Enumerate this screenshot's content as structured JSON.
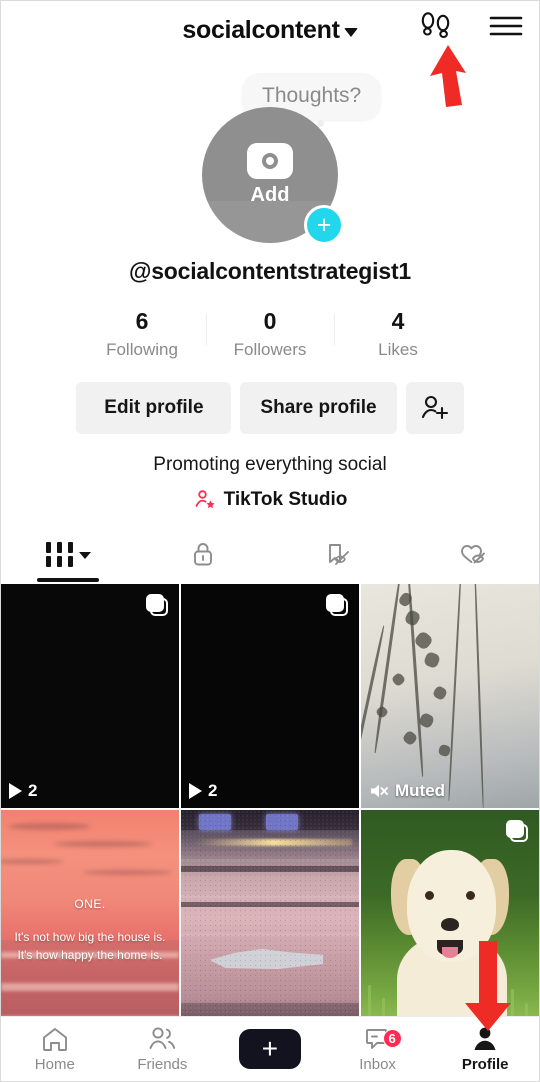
{
  "header": {
    "title": "socialcontent",
    "dropdown_icon": "chevron-down-icon",
    "footprints_icon": "footprints-icon",
    "menu_icon": "hamburger-menu-icon"
  },
  "profile": {
    "thoughts_placeholder": "Thoughts?",
    "avatar_label": "Add",
    "avatar_icon": "camera-icon",
    "add_badge": "+",
    "add_badge_color": "#22d6ec",
    "username": "@socialcontentstrategist1",
    "stats": [
      {
        "value": "6",
        "label": "Following"
      },
      {
        "value": "0",
        "label": "Followers"
      },
      {
        "value": "4",
        "label": "Likes"
      }
    ],
    "buttons": {
      "edit_profile": "Edit profile",
      "share_profile": "Share profile",
      "add_friends_icon": "add-person-icon"
    },
    "bio": "Promoting everything social",
    "studio_label": "TikTok Studio",
    "studio_icon": "person-star-icon",
    "studio_icon_color": "#fe2c55"
  },
  "tabs": [
    {
      "name": "posts",
      "icon": "grid-dashes-icon",
      "has_chevron": true,
      "active": true
    },
    {
      "name": "private",
      "icon": "lock-icon",
      "active": false
    },
    {
      "name": "reposts",
      "icon": "bookmark-slash-icon",
      "active": false
    },
    {
      "name": "liked",
      "icon": "heart-slash-icon",
      "active": false
    }
  ],
  "posts": [
    {
      "id": "post-1",
      "type": "video",
      "thumbnail": "black",
      "play_count": "2",
      "carousel_badge": true,
      "muted_badge": false
    },
    {
      "id": "post-2",
      "type": "video",
      "thumbnail": "black",
      "play_count": "2",
      "carousel_badge": true,
      "muted_badge": false
    },
    {
      "id": "post-3",
      "type": "photo",
      "thumbnail": "grass-silhouette",
      "muted_label": "Muted",
      "muted_icon": "speaker-mute-icon",
      "carousel_badge": false
    },
    {
      "id": "post-4",
      "type": "photo",
      "thumbnail": "sunset-beach",
      "overlay_title": "ONE.",
      "overlay_line1": "It's not how big the house is.",
      "overlay_line2": "It's how happy the home is.",
      "carousel_badge": false
    },
    {
      "id": "post-5",
      "type": "photo",
      "thumbnail": "stadium-concert-crowd",
      "carousel_badge": false
    },
    {
      "id": "post-6",
      "type": "photo",
      "thumbnail": "golden-retriever-puppy",
      "carousel_badge": true
    }
  ],
  "bottom_nav": [
    {
      "name": "home",
      "label": "Home",
      "icon": "house-icon",
      "active": false
    },
    {
      "name": "friends",
      "label": "Friends",
      "icon": "friends-icon",
      "active": false
    },
    {
      "name": "create",
      "label": "",
      "icon": "plus-icon",
      "active": false
    },
    {
      "name": "inbox",
      "label": "Inbox",
      "icon": "message-icon",
      "badge": "6",
      "active": false
    },
    {
      "name": "profile",
      "label": "Profile",
      "icon": "person-icon",
      "active": true
    }
  ],
  "annotations": [
    {
      "name": "arrow-to-footprints-icon",
      "color": "#ee2b24",
      "direction": "up"
    },
    {
      "name": "arrow-to-profile-tab",
      "color": "#ee2b24",
      "direction": "down"
    }
  ]
}
